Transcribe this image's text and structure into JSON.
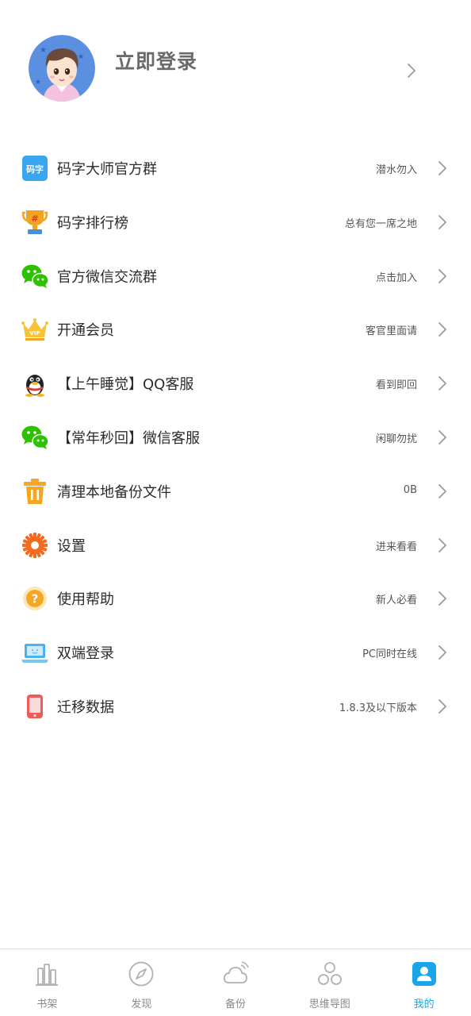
{
  "profile": {
    "login_label": "立即登录"
  },
  "menu": {
    "items": [
      {
        "label": "码字大师官方群",
        "value": "潜水勿入",
        "icon": "mazi-group-icon",
        "badge_text": "码字"
      },
      {
        "label": "码字排行榜",
        "value": "总有您一席之地",
        "icon": "trophy-icon"
      },
      {
        "label": "官方微信交流群",
        "value": "点击加入",
        "icon": "wechat-icon"
      },
      {
        "label": "开通会员",
        "value": "客官里面请",
        "icon": "vip-crown-icon",
        "badge_text": "VIP"
      },
      {
        "label": "【上午睡觉】QQ客服",
        "value": "看到即回",
        "icon": "qq-penguin-icon"
      },
      {
        "label": "【常年秒回】微信客服",
        "value": "闲聊勿扰",
        "icon": "wechat-icon"
      },
      {
        "label": "清理本地备份文件",
        "value": "0B",
        "icon": "trash-icon"
      },
      {
        "label": "设置",
        "value": "进来看看",
        "icon": "gear-icon"
      },
      {
        "label": "使用帮助",
        "value": "新人必看",
        "icon": "help-icon"
      },
      {
        "label": "双端登录",
        "value": "PC同时在线",
        "icon": "laptop-icon"
      },
      {
        "label": "迁移数据",
        "value": "1.8.3及以下版本",
        "icon": "phone-migrate-icon"
      }
    ]
  },
  "tabbar": {
    "tabs": [
      {
        "label": "书架",
        "icon": "bookshelf-icon",
        "active": false
      },
      {
        "label": "发现",
        "icon": "compass-icon",
        "active": false
      },
      {
        "label": "备份",
        "icon": "cloud-icon",
        "active": false
      },
      {
        "label": "思维导图",
        "icon": "mindmap-icon",
        "active": false
      },
      {
        "label": "我的",
        "icon": "profile-icon",
        "active": true
      }
    ]
  },
  "colors": {
    "accent": "#1ba5e8",
    "wechat_green": "#2dc100",
    "trophy_orange": "#f2a320",
    "trash_orange": "#f5a623",
    "gear_orange": "#f56a1f",
    "laptop_blue": "#4ab2ec",
    "phone_red": "#ef5b5b"
  }
}
